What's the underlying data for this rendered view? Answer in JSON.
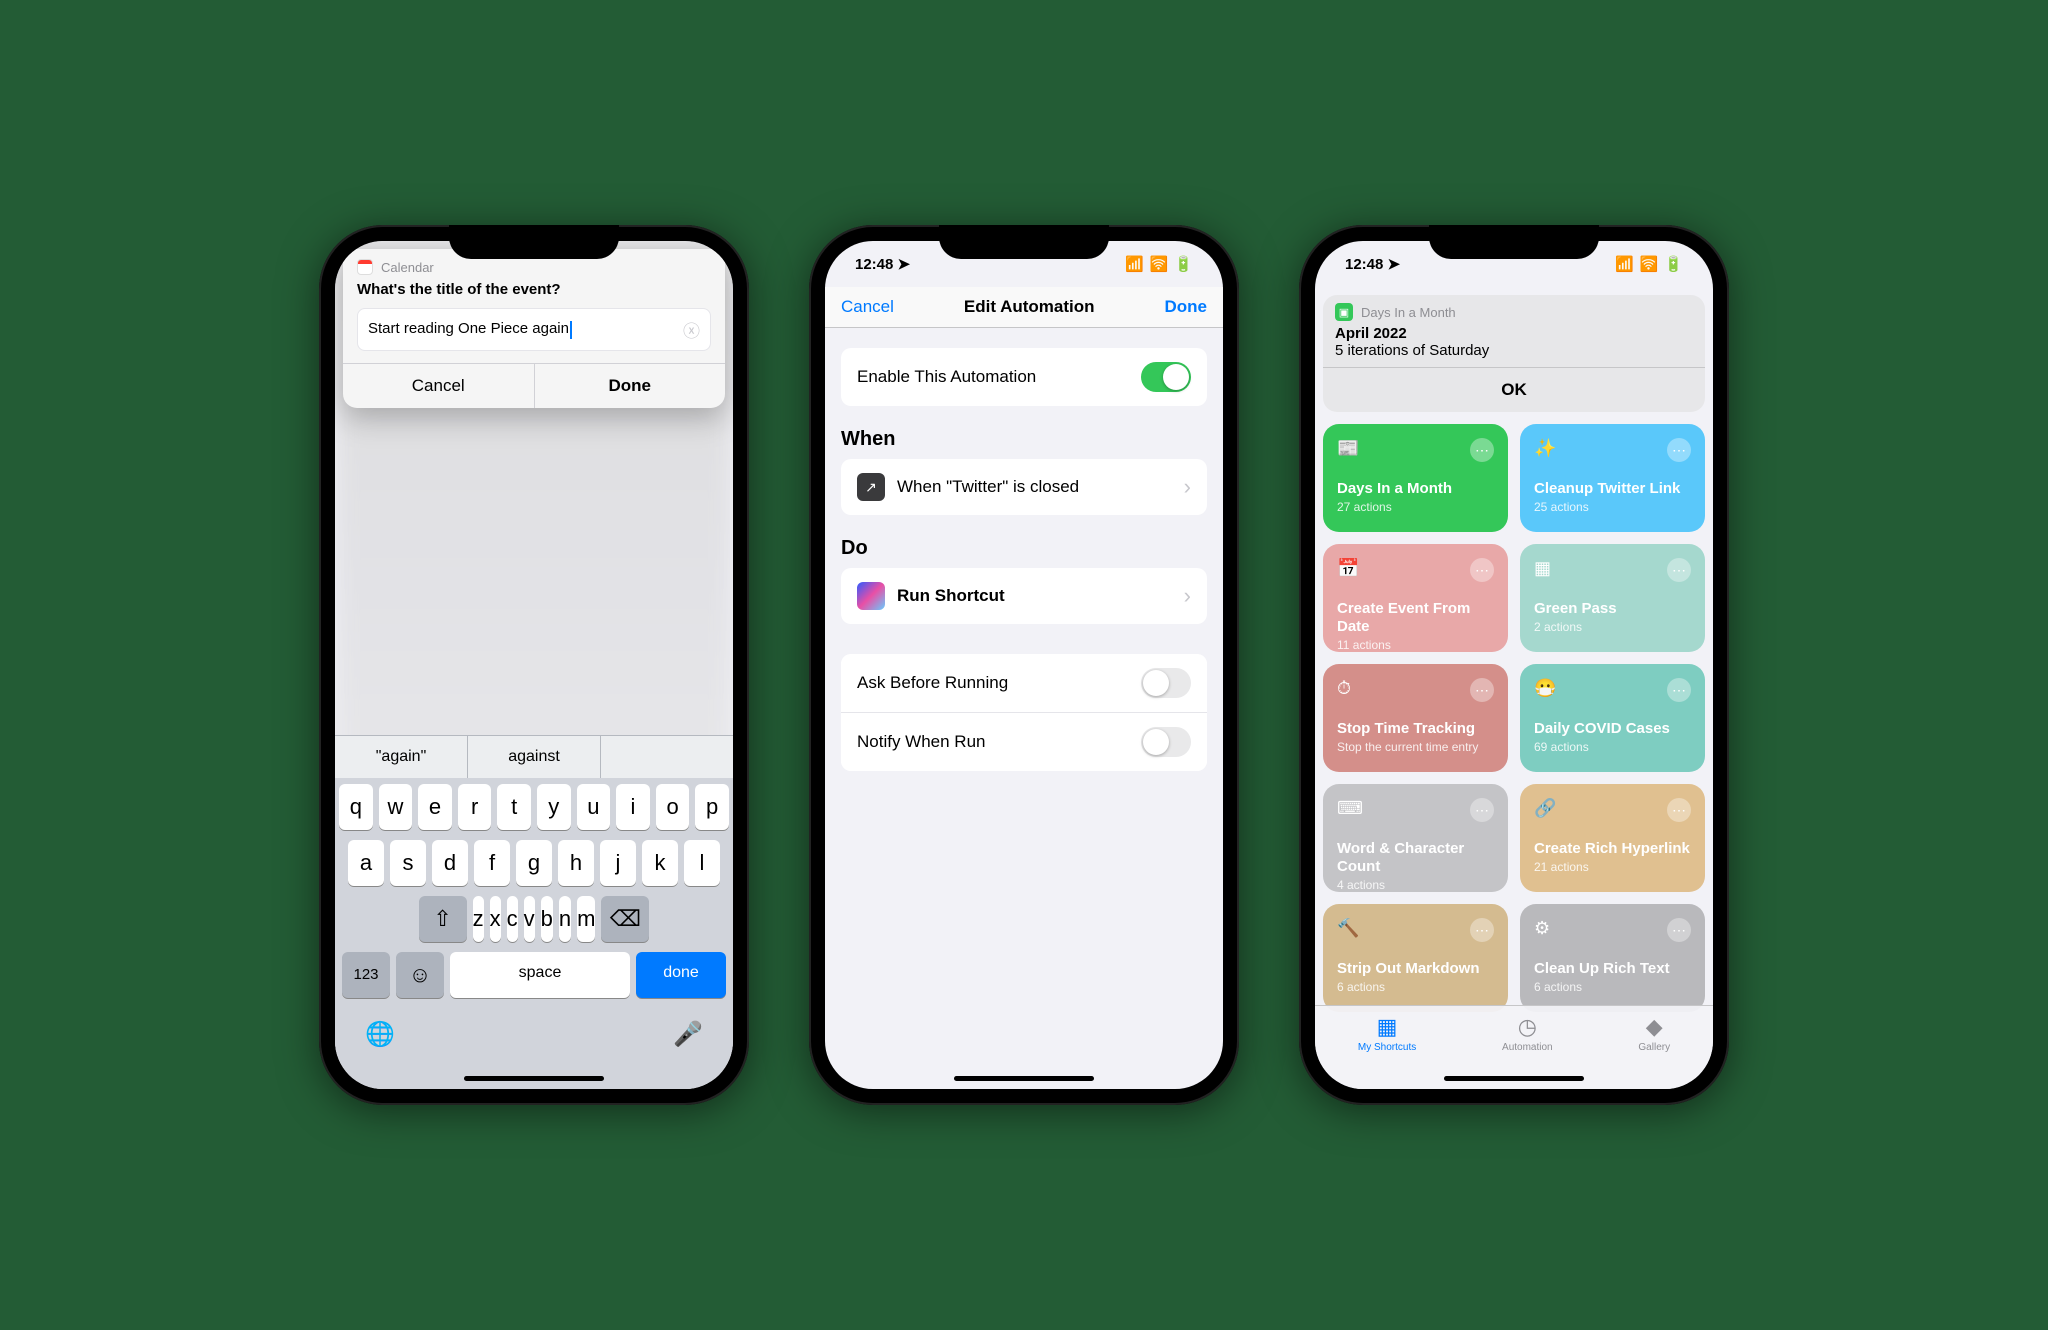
{
  "status": {
    "time": "12:48",
    "location_arrow": "➤",
    "signal": "▮▮▯▯",
    "wifi": "📶",
    "battery": "🔋"
  },
  "phone1": {
    "app_label": "Calendar",
    "prompt_title": "What's the title of the event?",
    "input_value": "Start reading One Piece again",
    "cancel_label": "Cancel",
    "done_label": "Done",
    "suggestions": [
      "\"again\"",
      "against",
      ""
    ],
    "keys_row1": [
      "q",
      "w",
      "e",
      "r",
      "t",
      "y",
      "u",
      "i",
      "o",
      "p"
    ],
    "keys_row2": [
      "a",
      "s",
      "d",
      "f",
      "g",
      "h",
      "j",
      "k",
      "l"
    ],
    "keys_row3": [
      "z",
      "x",
      "c",
      "v",
      "b",
      "n",
      "m"
    ],
    "key_123": "123",
    "key_space": "space",
    "key_done": "done"
  },
  "phone2": {
    "cancel_label": "Cancel",
    "title": "Edit Automation",
    "done_label": "Done",
    "enable_label": "Enable This Automation",
    "enable_on": true,
    "when_header": "When",
    "when_text": "When \"Twitter\" is closed",
    "do_header": "Do",
    "do_text": "Run Shortcut",
    "ask_label": "Ask Before Running",
    "ask_on": false,
    "notify_label": "Notify When Run",
    "notify_on": false
  },
  "phone3": {
    "notif_app": "Days In a Month",
    "notif_title": "April 2022",
    "notif_body": "5 iterations of Saturday",
    "notif_ok": "OK",
    "tiles": [
      {
        "name": "Days In a Month",
        "sub": "27 actions",
        "color": "#34c759",
        "icon": "📰"
      },
      {
        "name": "Cleanup Twitter Link",
        "sub": "25 actions",
        "color": "#5ac8fa",
        "icon": "✨"
      },
      {
        "name": "Create Event From Date",
        "sub": "11 actions",
        "color": "#e8a8a8",
        "icon": "📅"
      },
      {
        "name": "Green Pass",
        "sub": "2 actions",
        "color": "#a5d8ce",
        "icon": "▦"
      },
      {
        "name": "Stop Time Tracking",
        "sub": "Stop the current time entry",
        "color": "#d48f8a",
        "icon": "⏱"
      },
      {
        "name": "Daily COVID Cases",
        "sub": "69 actions",
        "color": "#7ecdc1",
        "icon": "😷"
      },
      {
        "name": "Word & Character Count",
        "sub": "4 actions",
        "color": "#c4c4c7",
        "icon": "⌨"
      },
      {
        "name": "Create Rich Hyperlink",
        "sub": "21 actions",
        "color": "#e0c090",
        "icon": "🔗"
      },
      {
        "name": "Strip Out Markdown",
        "sub": "6 actions",
        "color": "#d4bb90",
        "icon": "🔨"
      },
      {
        "name": "Clean Up Rich Text",
        "sub": "6 actions",
        "color": "#b9b9bc",
        "icon": "⚙"
      }
    ],
    "tabs": {
      "shortcuts": "My Shortcuts",
      "automation": "Automation",
      "gallery": "Gallery"
    }
  }
}
